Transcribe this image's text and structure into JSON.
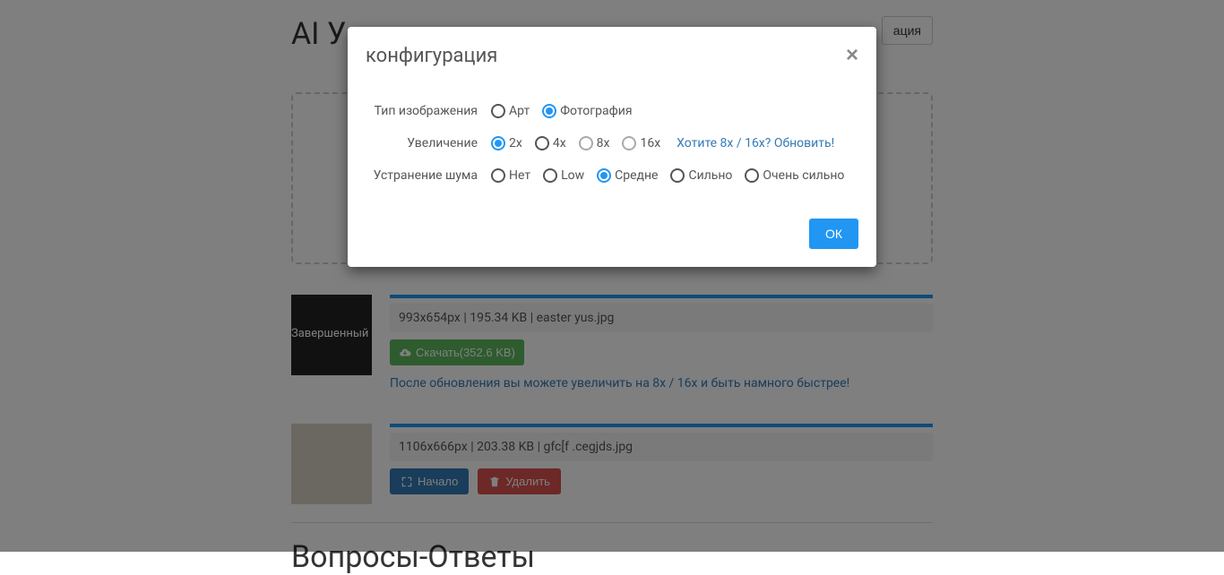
{
  "page": {
    "title": "AI У",
    "config_button": "ация",
    "faq_title": "Вопросы-Ответы"
  },
  "items": [
    {
      "status": "Завершенный",
      "info": "993x654px | 195.34 KB | easter yus.jpg",
      "download_label": "Скачать(352.6 KB)",
      "promo": "После обновления вы можете увеличить на 8x / 16x и быть намного быстрее!"
    },
    {
      "info": "1106x666px | 203.38 KB | gfc[f .cegjds.jpg",
      "start_label": "Начало",
      "delete_label": "Удалить"
    }
  ],
  "modal": {
    "title": "конфигурация",
    "ok_label": "ОК",
    "rows": {
      "image_type": {
        "label": "Тип изображения",
        "options": {
          "art": "Арт",
          "photo": "Фотография"
        },
        "selected": "photo"
      },
      "upscale": {
        "label": "Увеличение",
        "options": {
          "2x": "2x",
          "4x": "4x",
          "8x": "8x",
          "16x": "16x"
        },
        "selected": "2x",
        "upgrade_link": "Хотите 8x / 16x? Обновить!"
      },
      "denoise": {
        "label": "Устранение шума",
        "options": {
          "none": "Нет",
          "low": "Low",
          "medium": "Средне",
          "high": "Сильно",
          "highest": "Очень сильно"
        },
        "selected": "medium"
      }
    }
  }
}
